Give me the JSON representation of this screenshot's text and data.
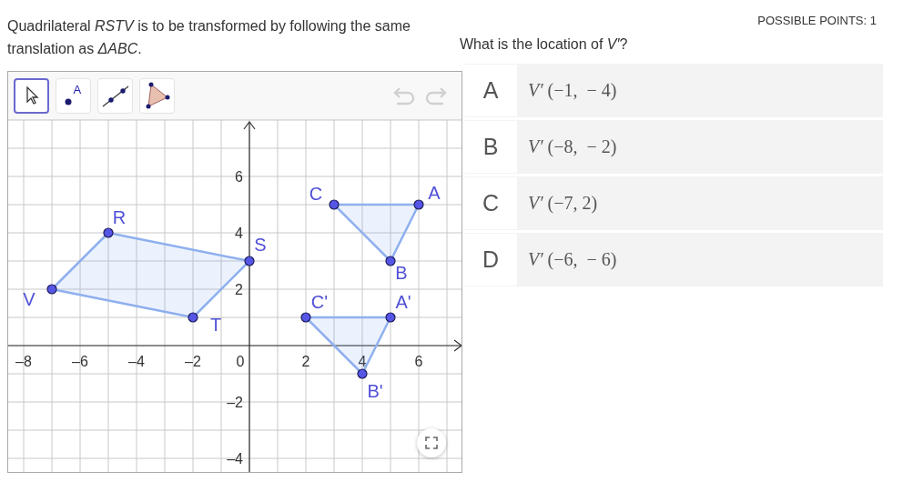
{
  "question": {
    "text": "Quadrilateral *RSTV* is to be transformed by following the same translation as *ΔABC*."
  },
  "graph": {
    "tools": [
      {
        "kind": "move",
        "selected": true
      },
      {
        "kind": "point",
        "label": "A",
        "selected": false
      },
      {
        "kind": "line",
        "selected": false
      },
      {
        "kind": "polygon",
        "selected": false
      }
    ],
    "x_tick_labels": [
      "–8",
      "–6",
      "–4",
      "–2",
      "0",
      "2",
      "4",
      "6"
    ],
    "y_tick_labels": [
      "6",
      "4",
      "2",
      "–2",
      "–4"
    ],
    "figures": [
      {
        "kind": "quadrilateral",
        "vertices": [
          "R",
          "S",
          "T",
          "V"
        ]
      },
      {
        "kind": "triangle",
        "vertices": [
          "A",
          "B",
          "C"
        ]
      },
      {
        "kind": "image-triangle",
        "vertices": [
          "A'",
          "B'",
          "C'"
        ]
      }
    ]
  },
  "points": "POSSIBLE POINTS: 1",
  "prompt": "What is the location of *V′*?",
  "choices": [
    {
      "letter": "A",
      "text": "*V′* (−1,  − 4)",
      "selected": false
    },
    {
      "letter": "B",
      "text": "*V′* (−8,  − 2)",
      "selected": false
    },
    {
      "letter": "C",
      "text": "*V′* (−7, 2)",
      "selected": false
    },
    {
      "letter": "D",
      "text": "*V′* (−6,  − 6)",
      "selected": false
    }
  ]
}
